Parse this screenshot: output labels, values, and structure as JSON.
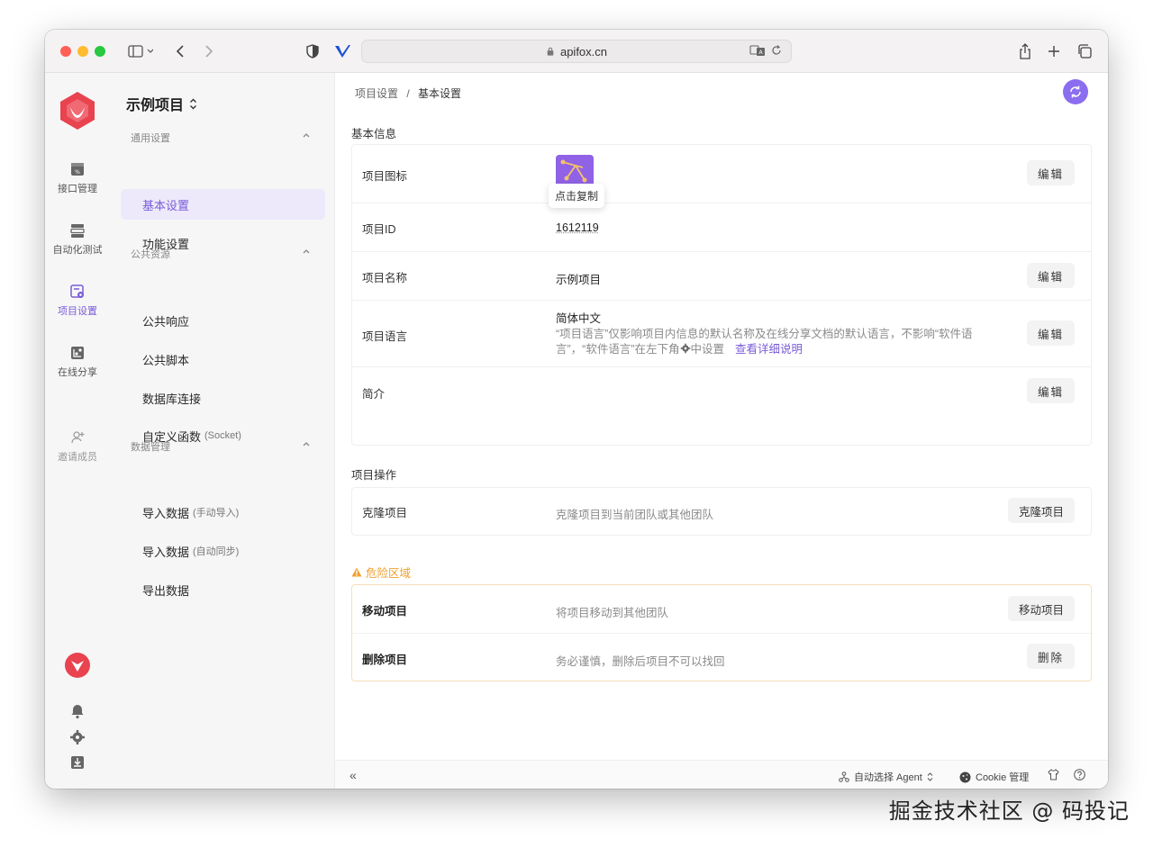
{
  "browser": {
    "url": "apifox.cn",
    "icons": [
      "sidebar-toggle-icon",
      "back-icon",
      "forward-icon",
      "shield-icon",
      "extension-icon",
      "translate-icon",
      "reload-icon",
      "share-icon",
      "new-tab-icon",
      "tabs-overview-icon"
    ]
  },
  "rail": {
    "items": [
      {
        "label": "接口管理"
      },
      {
        "label": "自动化测试"
      },
      {
        "label": "项目设置"
      },
      {
        "label": "在线分享"
      },
      {
        "label": "邀请成员"
      }
    ],
    "accent": "#7a5cd8"
  },
  "subnav": {
    "project": "示例项目",
    "groups": [
      {
        "title": "通用设置",
        "items": [
          "基本设置",
          "功能设置"
        ]
      },
      {
        "title": "公共资源",
        "items": [
          "公共响应",
          "公共脚本",
          "数据库连接",
          "自定义函数"
        ],
        "hint": "(Socket)"
      },
      {
        "title": "数据管理",
        "items": [
          "导入数据",
          "导入数据",
          "导出数据"
        ],
        "hints": [
          "(手动导入)",
          "(自动同步)"
        ]
      }
    ]
  },
  "main": {
    "breadcrumb": {
      "parent": "项目设置",
      "sep": "/",
      "current": "基本设置"
    },
    "basic": {
      "title": "基本信息",
      "icon_label": "项目图标",
      "tooltip": "点击复制",
      "id_label": "项目ID",
      "id_value": "1612119",
      "name_label": "项目名称",
      "name_value": "示例项目",
      "lang_label": "项目语言",
      "lang_value": "简体中文",
      "lang_desc": "“项目语言”仅影响项目内信息的默认名称及在线分享文档的默认语言，不影响“软件语言”，“软件语言”在左下角",
      "lang_desc2": "中设置",
      "lang_link": "查看详细说明",
      "intro_label": "简介",
      "edit": "编辑"
    },
    "ops": {
      "title": "项目操作",
      "clone_label": "克隆项目",
      "clone_desc": "克隆项目到当前团队或其他团队",
      "clone_btn": "克隆项目"
    },
    "danger": {
      "title": "危险区域",
      "move_label": "移动项目",
      "move_desc": "将项目移动到其他团队",
      "move_btn": "移动项目",
      "delete_label": "删除项目",
      "delete_desc": "务必谨慎，删除后项目不可以找回",
      "delete_btn": "删除",
      "color": "#f0a030"
    }
  },
  "footer": {
    "collapse": "«",
    "agent": "自动选择 Agent",
    "cookie": "Cookie 管理"
  },
  "watermark": "掘金技术社区 @ 码投记"
}
